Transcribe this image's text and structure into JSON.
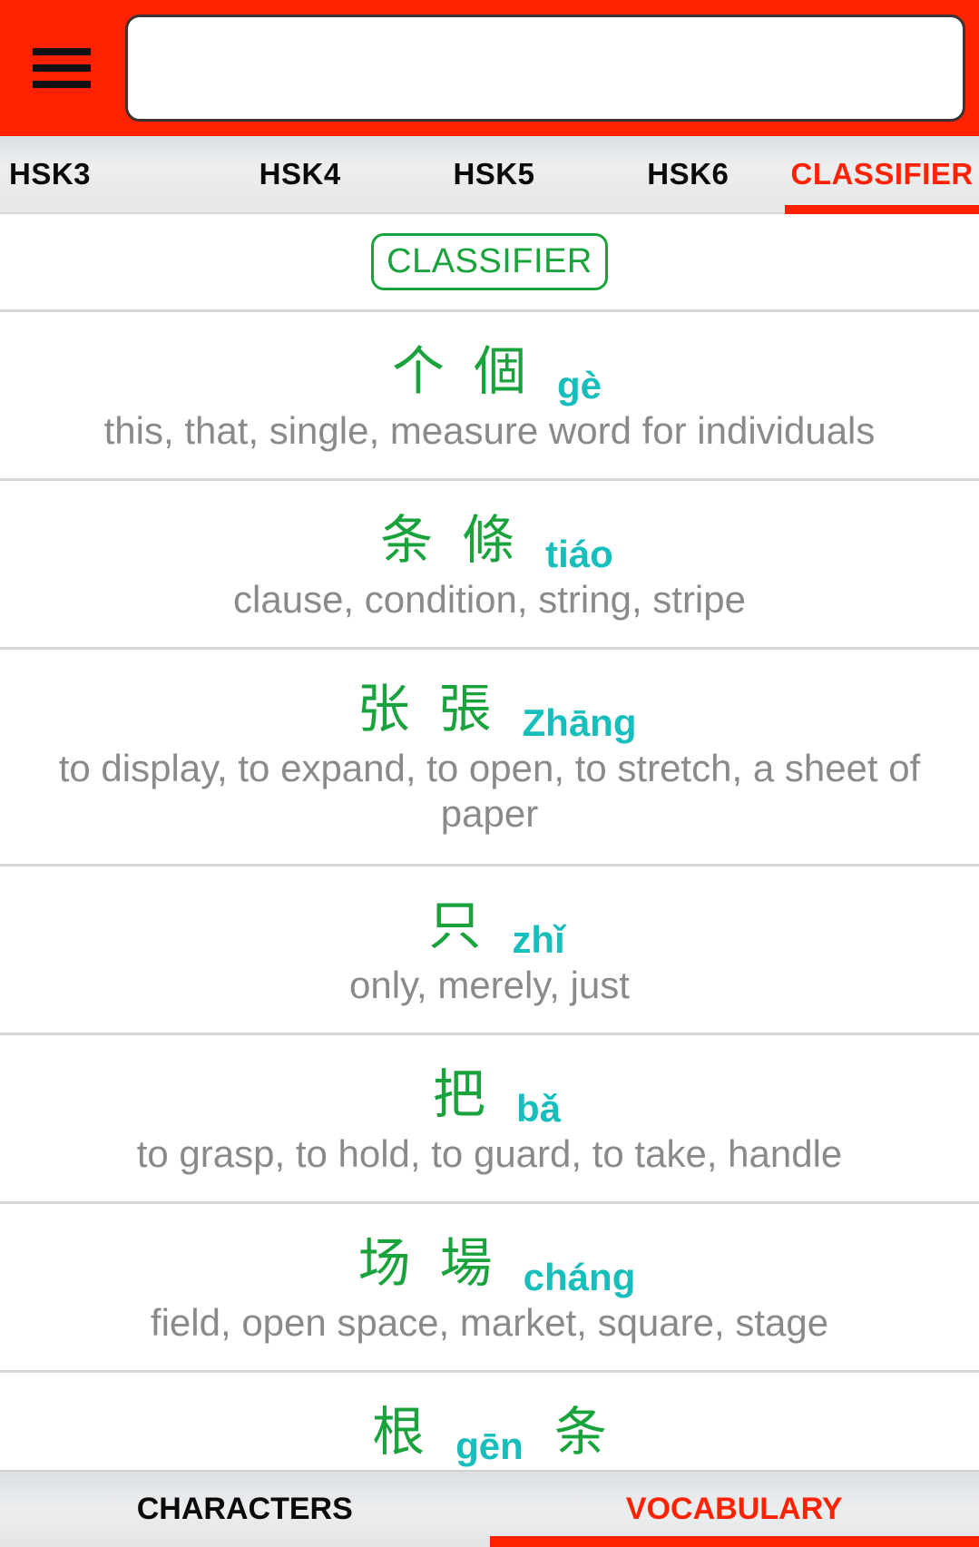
{
  "colors": {
    "brand": "#ff2200",
    "hanzi": "#1aa33c",
    "pinyin": "#17bebb",
    "meaning": "#8a8a8a"
  },
  "topbar": {
    "menu_icon": "hamburger-menu-icon",
    "search": {
      "value": "",
      "placeholder": ""
    }
  },
  "tabs": [
    {
      "label": "HSK3",
      "active": false
    },
    {
      "label": "HSK4",
      "active": false
    },
    {
      "label": "HSK5",
      "active": false
    },
    {
      "label": "HSK6",
      "active": false
    },
    {
      "label": "CLASSIFIER",
      "active": true
    }
  ],
  "section_badge": "CLASSIFIER",
  "entries": [
    {
      "simplified": "个",
      "traditional": "個",
      "pinyin": "gè",
      "meanings": [
        "this",
        "that",
        "single",
        "measure word for individuals"
      ]
    },
    {
      "simplified": "条",
      "traditional": "條",
      "pinyin": "tiáo",
      "meanings": [
        "clause",
        "condition",
        "string",
        "stripe"
      ]
    },
    {
      "simplified": "张",
      "traditional": "張",
      "pinyin": "Zhāng",
      "meanings": [
        "to display",
        "to expand",
        "to open",
        "to stretch",
        "a sheet of paper"
      ]
    },
    {
      "simplified": "只",
      "traditional": "",
      "pinyin": "zhǐ",
      "meanings": [
        "only",
        "merely",
        "just"
      ]
    },
    {
      "simplified": "把",
      "traditional": "",
      "pinyin": "bǎ",
      "meanings": [
        "to grasp",
        "to hold",
        "to guard",
        "to take",
        "handle"
      ]
    },
    {
      "simplified": "场",
      "traditional": "場",
      "pinyin": "cháng",
      "meanings": [
        "field",
        "open space",
        "market",
        "square",
        "stage"
      ]
    },
    {
      "simplified": "根",
      "traditional": "",
      "pinyin": "gēn",
      "extra": "条",
      "meanings": []
    }
  ],
  "bottom_tabs": [
    {
      "label": "CHARACTERS",
      "active": false
    },
    {
      "label": "VOCABULARY",
      "active": true
    }
  ]
}
